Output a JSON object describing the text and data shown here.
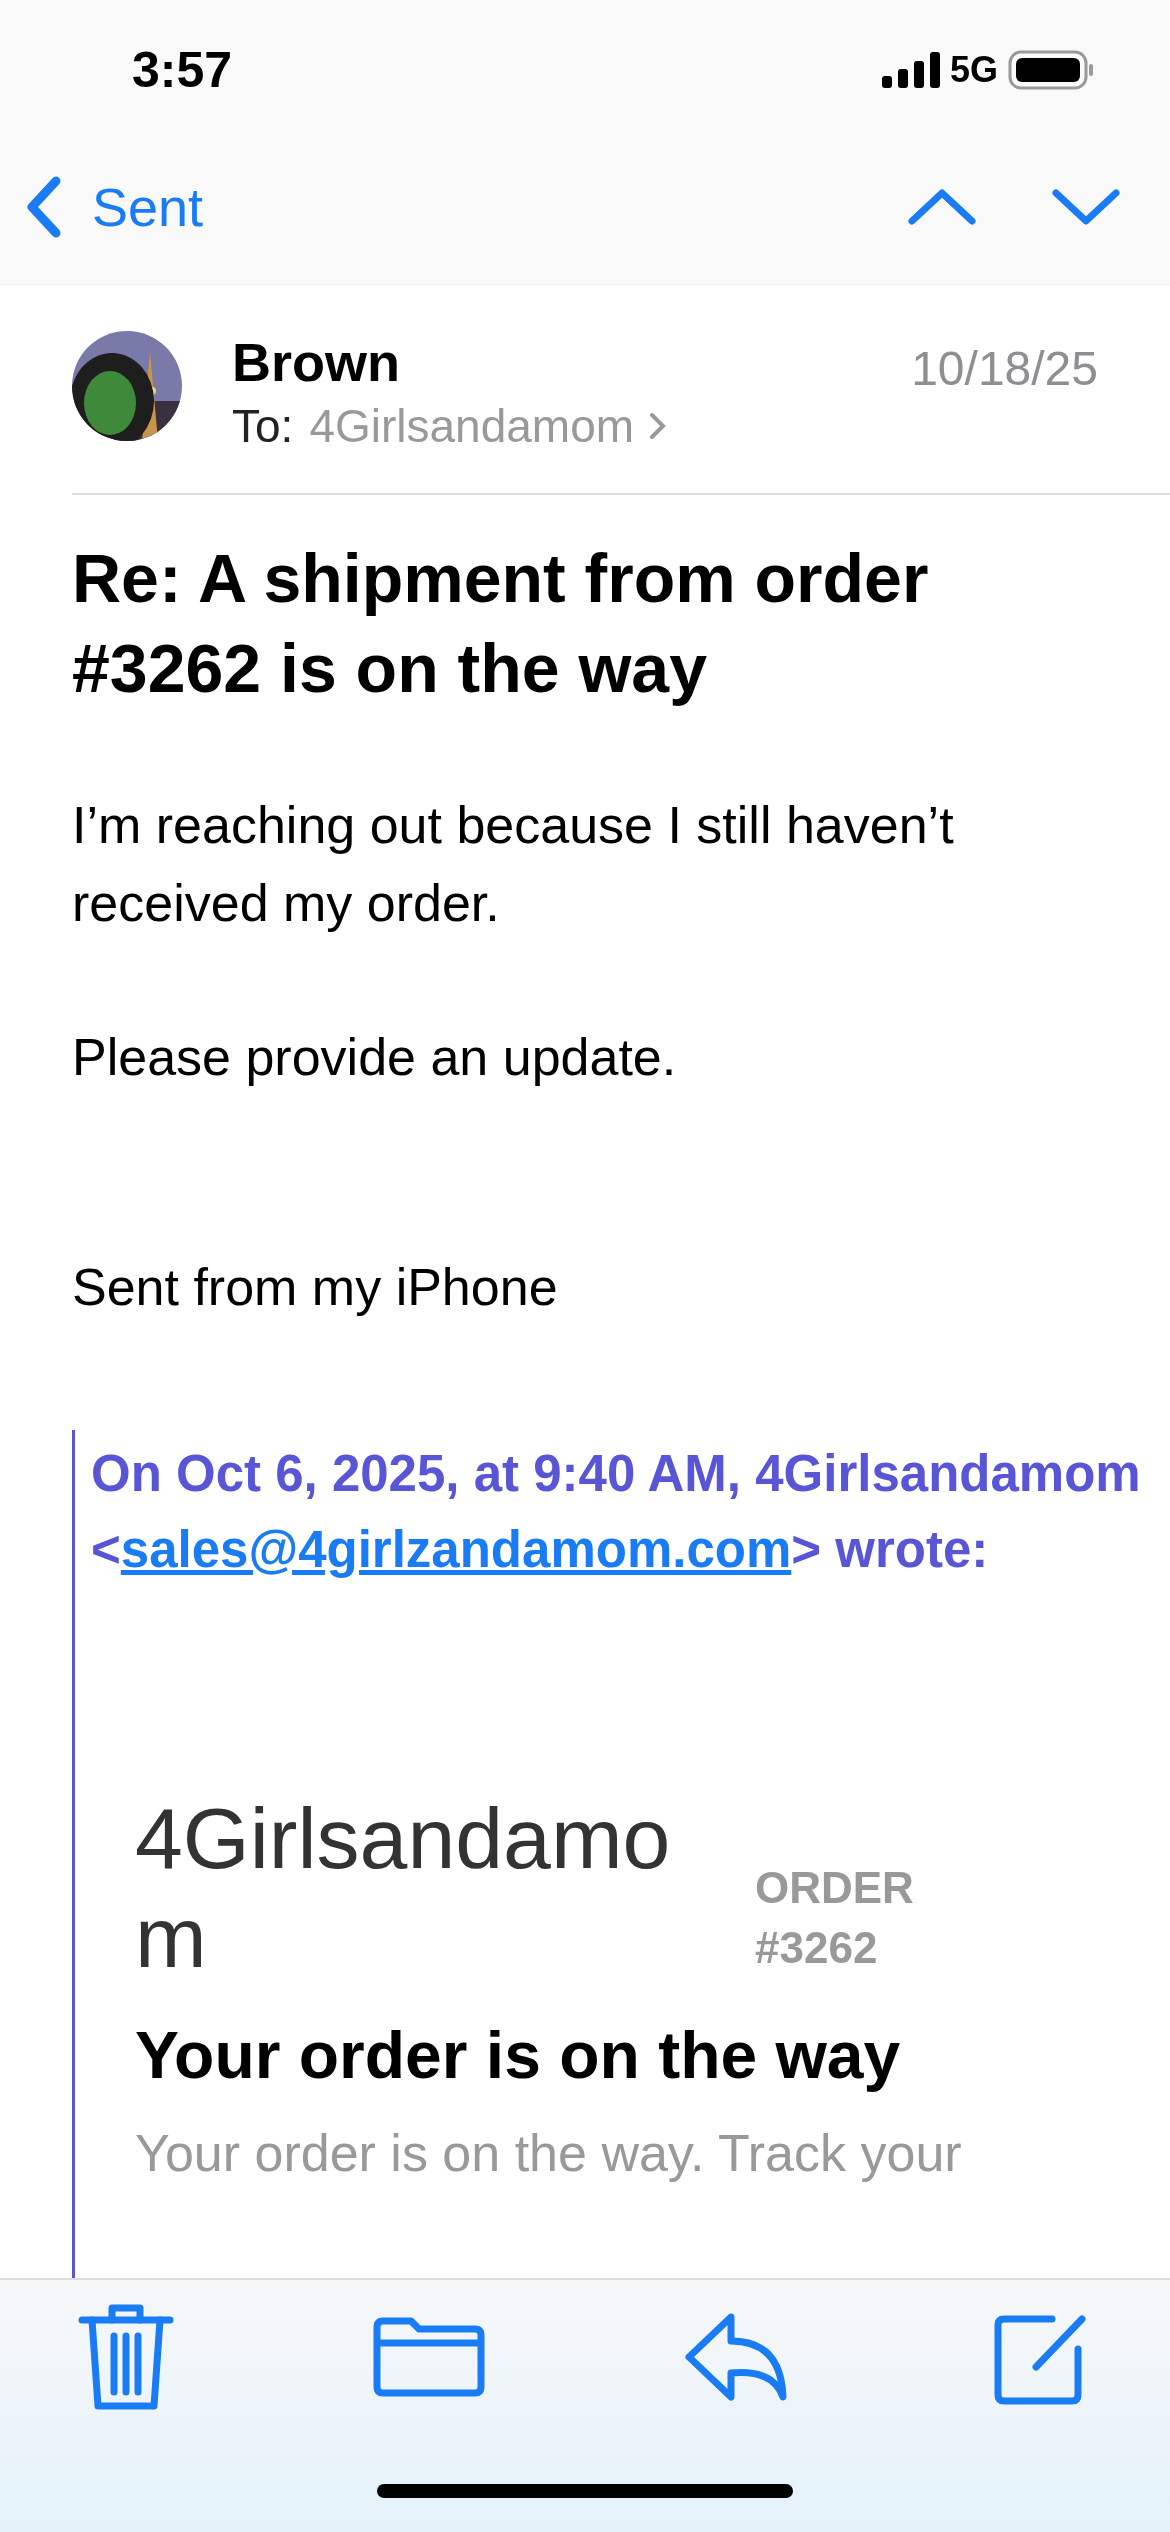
{
  "status_bar": {
    "time": "3:57",
    "network": "5G"
  },
  "nav": {
    "back_label": "Sent"
  },
  "message": {
    "sender": "Brown",
    "to_label": "To:",
    "recipient": "4Girlsandamom",
    "date": "10/18/25",
    "subject": "Re: A shipment from order #3262 is on the way",
    "body": [
      "I’m reaching out because I still haven’t received my order.",
      "Please provide an update.",
      "Sent from my iPhone"
    ]
  },
  "quote": {
    "header_start": "On Oct 6, 2025, at 9:40 AM, 4Girlsandamom <",
    "email": "sales@4girlzandamom.com",
    "header_end": "> wrote:",
    "store_name": "4Girlsandamom",
    "order_label": "ORDER",
    "order_number": "#3262",
    "headline": "Your order is on the way",
    "intro": "Your order is on the way. Track your"
  }
}
